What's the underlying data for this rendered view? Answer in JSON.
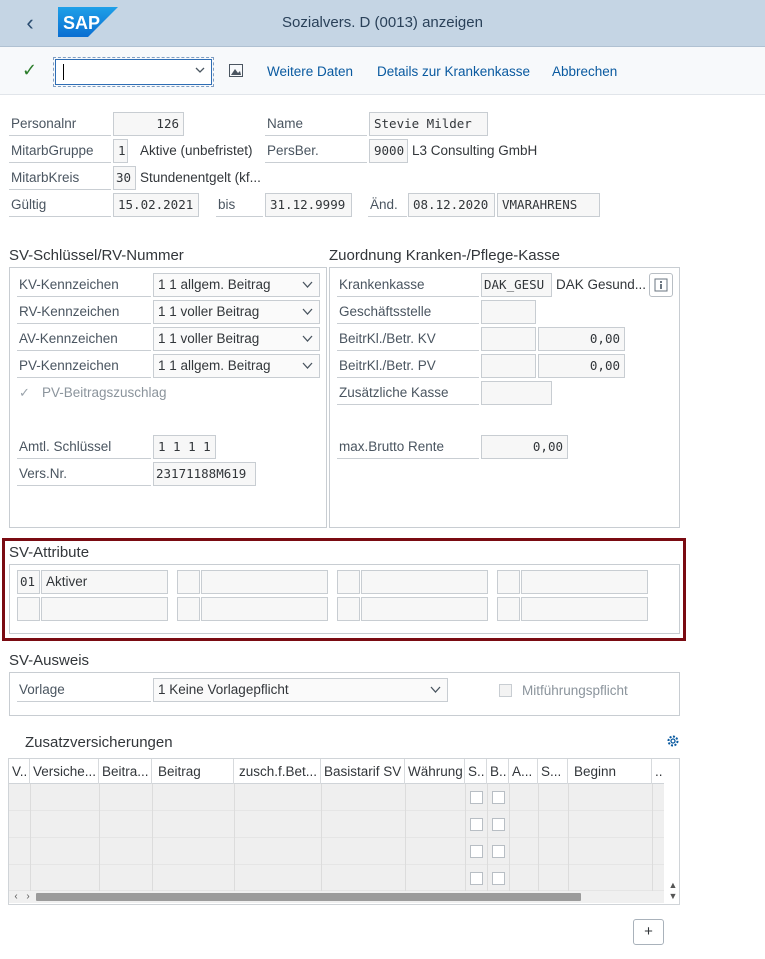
{
  "shell": {
    "title": "Sozialvers. D (0013) anzeigen",
    "logo": "SAP"
  },
  "toolbar": {
    "command_value": "",
    "buttons": [
      "Weitere Daten",
      "Details zur Krankenkasse",
      "Abbrechen"
    ]
  },
  "header": {
    "personalnr": {
      "label": "Personalnr",
      "value": "126"
    },
    "name": {
      "label": "Name",
      "value": "Stevie Milder"
    },
    "mitarbgruppe": {
      "label": "MitarbGruppe",
      "code": "1",
      "text": "Aktive (unbefristet)"
    },
    "persber": {
      "label": "PersBer.",
      "code": "9000",
      "text": "L3 Consulting GmbH"
    },
    "mitarbkreis": {
      "label": "MitarbKreis",
      "code": "30",
      "text": "Stundenentgelt (kf..."
    },
    "gueltig": {
      "label": "Gültig",
      "from": "15.02.2021",
      "bis_label": "bis",
      "to": "31.12.9999"
    },
    "aend": {
      "label": "Änd.",
      "date": "08.12.2020",
      "user": "VMARAHRENS"
    }
  },
  "sv_schluessel": {
    "title": "SV-Schlüssel/RV-Nummer",
    "kv": {
      "label": "KV-Kennzeichen",
      "value": "1 1 allgem. Beitrag"
    },
    "rv": {
      "label": "RV-Kennzeichen",
      "value": "1 1 voller Beitrag"
    },
    "av": {
      "label": "AV-Kennzeichen",
      "value": "1 1 voller Beitrag"
    },
    "pv": {
      "label": "PV-Kennzeichen",
      "value": "1 1 allgem. Beitrag"
    },
    "pv_zuschlag": {
      "label": "PV-Beitragszuschlag",
      "checked": true
    },
    "amtl": {
      "label": "Amtl. Schlüssel",
      "value": "1 1 1 1"
    },
    "versnr": {
      "label": "Vers.Nr.",
      "value": "23171188M619"
    }
  },
  "kasse": {
    "title": "Zuordnung Kranken-/Pflege-Kasse",
    "krankenkasse": {
      "label": "Krankenkasse",
      "code": "DAK_GESU",
      "text": "DAK Gesund..."
    },
    "geschaeftsstelle": {
      "label": "Geschäftsstelle"
    },
    "kv": {
      "label": "BeitrKl./Betr. KV",
      "value": "0,00"
    },
    "pv": {
      "label": "BeitrKl./Betr. PV",
      "value": "0,00"
    },
    "zus_kasse": {
      "label": "Zusätzliche Kasse"
    },
    "brutto": {
      "label": "max.Brutto Rente",
      "value": "0,00"
    }
  },
  "attribute": {
    "title": "SV-Attribute",
    "first": {
      "code": "01",
      "text": "Aktiver"
    }
  },
  "ausweis": {
    "title": "SV-Ausweis",
    "vorlage_label": "Vorlage",
    "vorlage_value": "1 Keine Vorlagepflicht",
    "mitfuehrung": "Mitführungspflicht"
  },
  "zusatz": {
    "title": "Zusatzversicherungen",
    "columns": [
      "V..",
      "Versiche...",
      "Beitra...",
      "Beitrag",
      "zusch.f.Bet...",
      "Basistarif SV",
      "Währung",
      "S..",
      "B..",
      "A...",
      "S...",
      "Beginn",
      ".."
    ]
  },
  "colors": {
    "shell": "#c5d5e4",
    "accent": "#0a5aa0",
    "highlight": "#7a0b12"
  }
}
